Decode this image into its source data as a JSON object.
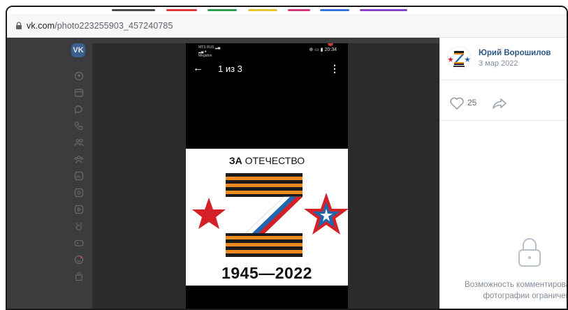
{
  "browser": {
    "url_host": "vk.com",
    "url_path": "/photo223255903_457240785",
    "tab_colors": [
      "#4a4a4a",
      "#e03b3b",
      "#2e9e55",
      "#e8c43a",
      "#d4387f",
      "#3a77d8",
      "#8a44c8"
    ]
  },
  "sidebar": {
    "logo_text": "VK",
    "icons": [
      "user-icon",
      "news-icon",
      "messages-icon",
      "calls-icon",
      "friends-icon",
      "communities-icon",
      "photos-icon",
      "music-icon",
      "video-icon",
      "clips-icon",
      "games-icon",
      "stickers-icon",
      "market-icon"
    ]
  },
  "phone": {
    "carrier": "MTS RUS",
    "carrier2": "Megafon",
    "status_right": "⊕ ▭ ▮ 20:34",
    "back_glyph": "←",
    "counter": "1 из 3",
    "menu_glyph": "⋮"
  },
  "poster": {
    "title_bold": "ЗА",
    "title_rest": " ОТЕЧЕСТВО",
    "years": "1945—2022",
    "colors": {
      "red": "#d42027",
      "blue": "#1f67ae",
      "orange": "#ee8a1e",
      "black": "#1a1a1a"
    }
  },
  "panel": {
    "author_name": "Юрий Ворошилов",
    "date": "3 мар 2022",
    "likes": "25",
    "comments_closed_line1": "Возможность комментирова",
    "comments_closed_line2": "фотографии ограничен"
  },
  "colors": {
    "link": "#2a5885",
    "muted": "#818c99",
    "overlay": "#3b3c3d"
  }
}
